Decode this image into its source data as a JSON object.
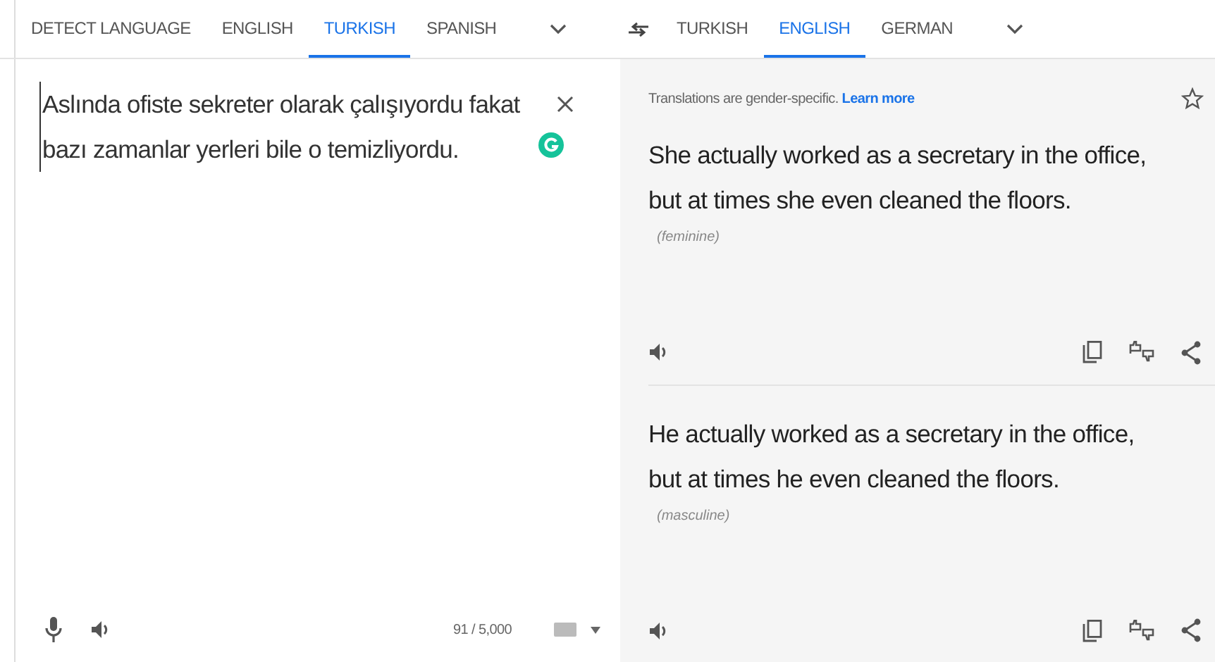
{
  "source_tabs": [
    {
      "label": "DETECT LANGUAGE",
      "selected": false
    },
    {
      "label": "ENGLISH",
      "selected": false
    },
    {
      "label": "TURKISH",
      "selected": true
    },
    {
      "label": "SPANISH",
      "selected": false
    }
  ],
  "target_tabs": [
    {
      "label": "TURKISH",
      "selected": false
    },
    {
      "label": "ENGLISH",
      "selected": true
    },
    {
      "label": "GERMAN",
      "selected": false
    }
  ],
  "source": {
    "text": "Aslında ofiste sekreter olarak çalışıyordu fakat bazı zamanlar yerleri bile o temizliyordu.",
    "char_count": "91 / 5,000"
  },
  "notice": {
    "text": "Translations are gender-specific.",
    "link": "Learn more"
  },
  "translations": [
    {
      "text": "She actually worked as a secretary in the office, but at times she even cleaned the floors.",
      "gender": "(feminine)"
    },
    {
      "text": "He actually worked as a secretary in the office, but at times he even cleaned the floors.",
      "gender": "(masculine)"
    }
  ]
}
